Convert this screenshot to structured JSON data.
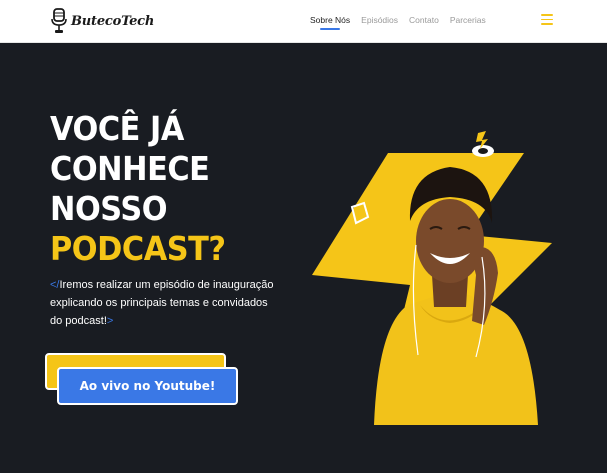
{
  "brand": {
    "name": "ButecoTech"
  },
  "nav": {
    "items": [
      {
        "label": "Sobre Nós",
        "active": true
      },
      {
        "label": "Episódios",
        "active": false
      },
      {
        "label": "Contato",
        "active": false
      },
      {
        "label": "Parcerias",
        "active": false
      }
    ]
  },
  "hero": {
    "headline_lines": [
      "VOCÊ JÁ",
      "CONHECE",
      "NOSSO"
    ],
    "headline_highlight": "PODCAST?",
    "description": {
      "open_tag": "</",
      "text": "Iremos realizar um episódio de inauguração explicando os principais temas e convidados do podcast!",
      "close_tag": ">"
    },
    "cta_label": "Ao vivo no Youtube!"
  },
  "colors": {
    "accent_yellow": "#f5c518",
    "accent_blue": "#3a78e6",
    "hero_background": "#191c22"
  },
  "icons": [
    "microphone-logo-icon",
    "hamburger-menu-icon",
    "lightning-bolt-icon",
    "podcast-logo-badge-icon",
    "vinyl-record-icon"
  ]
}
